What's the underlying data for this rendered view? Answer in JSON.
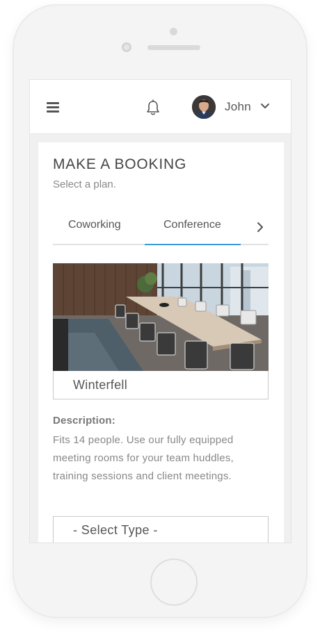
{
  "header": {
    "user_name": "John",
    "icons": [
      "hamburger-menu-icon",
      "bell-icon",
      "avatar",
      "chevron-down-icon"
    ]
  },
  "booking": {
    "title": "MAKE A BOOKING",
    "subtitle": "Select a plan.",
    "tabs": [
      {
        "label": "Coworking",
        "active": false
      },
      {
        "label": "Conference",
        "active": true
      }
    ],
    "tab_accent_color": "#3a9ad9",
    "room": {
      "name": "Winterfell",
      "description_label": "Description:",
      "description": "Fits 14 people. Use our fully equipped meeting rooms for your team huddles, training sessions and client meetings."
    },
    "type_select": {
      "value": "- Select Type -"
    }
  }
}
